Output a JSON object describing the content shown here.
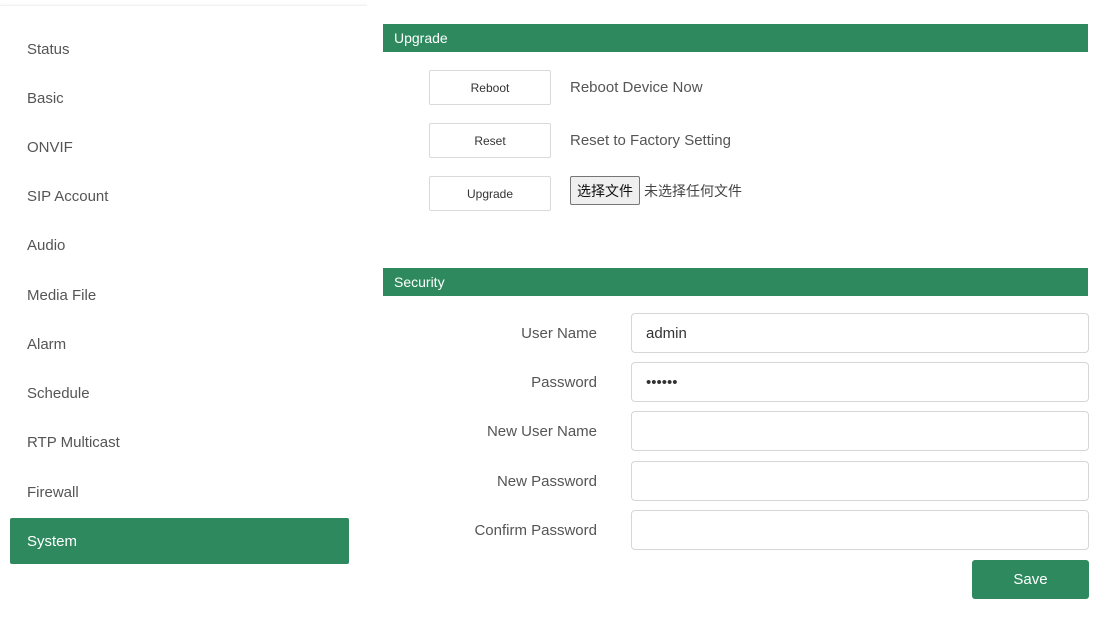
{
  "sidebar": {
    "items": [
      {
        "label": "Status"
      },
      {
        "label": "Basic"
      },
      {
        "label": "ONVIF"
      },
      {
        "label": "SIP Account"
      },
      {
        "label": "Audio"
      },
      {
        "label": "Media File"
      },
      {
        "label": "Alarm"
      },
      {
        "label": "Schedule"
      },
      {
        "label": "RTP Multicast"
      },
      {
        "label": "Firewall"
      },
      {
        "label": "System"
      }
    ],
    "active": "System"
  },
  "upgrade": {
    "title": "Upgrade",
    "reboot_button": "Reboot",
    "reboot_desc": "Reboot Device Now",
    "reset_button": "Reset",
    "reset_desc": "Reset to Factory Setting",
    "upgrade_button": "Upgrade",
    "file_button": "选择文件",
    "file_status": "未选择任何文件"
  },
  "security": {
    "title": "Security",
    "user_name_label": "User Name",
    "user_name_value": "admin",
    "password_label": "Password",
    "password_value": "••••••",
    "new_user_name_label": "New User Name",
    "new_user_name_value": "",
    "new_password_label": "New Password",
    "new_password_value": "",
    "confirm_password_label": "Confirm Password",
    "confirm_password_value": "",
    "save_button": "Save"
  },
  "colors": {
    "accent": "#2e8a5e"
  }
}
